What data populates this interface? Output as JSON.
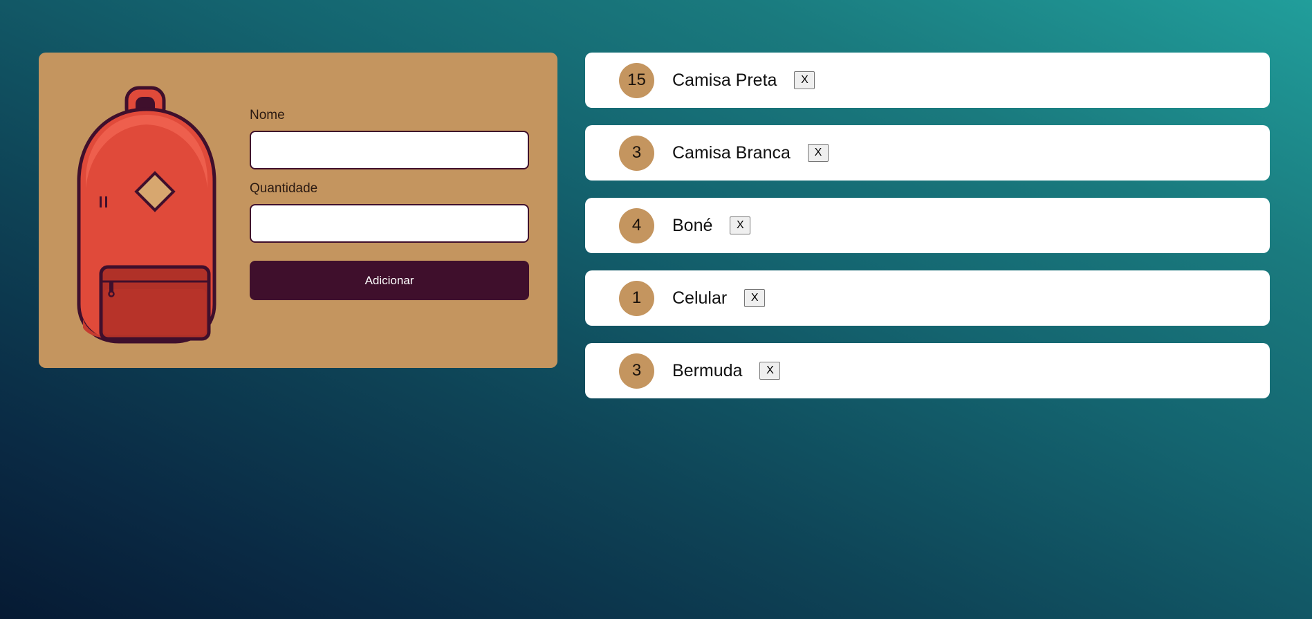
{
  "form": {
    "name_label": "Nome",
    "name_value": "",
    "quantity_label": "Quantidade",
    "quantity_value": "",
    "submit_label": "Adicionar",
    "illustration": "backpack-icon"
  },
  "items": [
    {
      "quantity": "15",
      "name": "Camisa Preta",
      "remove_label": "X"
    },
    {
      "quantity": "3",
      "name": "Camisa Branca",
      "remove_label": "X"
    },
    {
      "quantity": "4",
      "name": "Boné",
      "remove_label": "X"
    },
    {
      "quantity": "1",
      "name": "Celular",
      "remove_label": "X"
    },
    {
      "quantity": "3",
      "name": "Bermuda",
      "remove_label": "X"
    }
  ],
  "colors": {
    "card_background": "#c4955f",
    "button_background": "#3f0f2c",
    "quantity_badge": "#c4955f",
    "backpack_body": "#e04a3a",
    "backpack_outline": "#3f0f2c"
  }
}
